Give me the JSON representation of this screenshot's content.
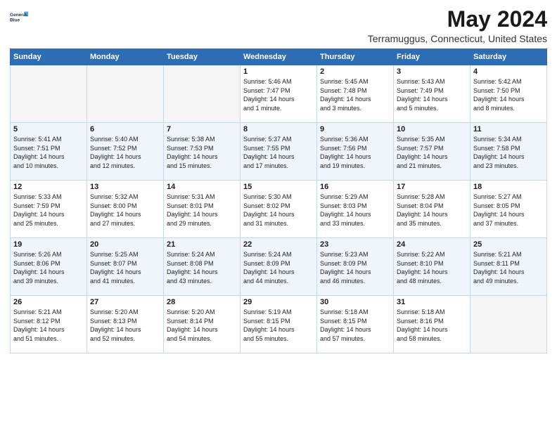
{
  "header": {
    "logo_line1": "General",
    "logo_line2": "Blue",
    "month_title": "May 2024",
    "location": "Terramuggus, Connecticut, United States"
  },
  "days_of_week": [
    "Sunday",
    "Monday",
    "Tuesday",
    "Wednesday",
    "Thursday",
    "Friday",
    "Saturday"
  ],
  "weeks": [
    [
      {
        "day": "",
        "info": ""
      },
      {
        "day": "",
        "info": ""
      },
      {
        "day": "",
        "info": ""
      },
      {
        "day": "1",
        "info": "Sunrise: 5:46 AM\nSunset: 7:47 PM\nDaylight: 14 hours\nand 1 minute."
      },
      {
        "day": "2",
        "info": "Sunrise: 5:45 AM\nSunset: 7:48 PM\nDaylight: 14 hours\nand 3 minutes."
      },
      {
        "day": "3",
        "info": "Sunrise: 5:43 AM\nSunset: 7:49 PM\nDaylight: 14 hours\nand 5 minutes."
      },
      {
        "day": "4",
        "info": "Sunrise: 5:42 AM\nSunset: 7:50 PM\nDaylight: 14 hours\nand 8 minutes."
      }
    ],
    [
      {
        "day": "5",
        "info": "Sunrise: 5:41 AM\nSunset: 7:51 PM\nDaylight: 14 hours\nand 10 minutes."
      },
      {
        "day": "6",
        "info": "Sunrise: 5:40 AM\nSunset: 7:52 PM\nDaylight: 14 hours\nand 12 minutes."
      },
      {
        "day": "7",
        "info": "Sunrise: 5:38 AM\nSunset: 7:53 PM\nDaylight: 14 hours\nand 15 minutes."
      },
      {
        "day": "8",
        "info": "Sunrise: 5:37 AM\nSunset: 7:55 PM\nDaylight: 14 hours\nand 17 minutes."
      },
      {
        "day": "9",
        "info": "Sunrise: 5:36 AM\nSunset: 7:56 PM\nDaylight: 14 hours\nand 19 minutes."
      },
      {
        "day": "10",
        "info": "Sunrise: 5:35 AM\nSunset: 7:57 PM\nDaylight: 14 hours\nand 21 minutes."
      },
      {
        "day": "11",
        "info": "Sunrise: 5:34 AM\nSunset: 7:58 PM\nDaylight: 14 hours\nand 23 minutes."
      }
    ],
    [
      {
        "day": "12",
        "info": "Sunrise: 5:33 AM\nSunset: 7:59 PM\nDaylight: 14 hours\nand 25 minutes."
      },
      {
        "day": "13",
        "info": "Sunrise: 5:32 AM\nSunset: 8:00 PM\nDaylight: 14 hours\nand 27 minutes."
      },
      {
        "day": "14",
        "info": "Sunrise: 5:31 AM\nSunset: 8:01 PM\nDaylight: 14 hours\nand 29 minutes."
      },
      {
        "day": "15",
        "info": "Sunrise: 5:30 AM\nSunset: 8:02 PM\nDaylight: 14 hours\nand 31 minutes."
      },
      {
        "day": "16",
        "info": "Sunrise: 5:29 AM\nSunset: 8:03 PM\nDaylight: 14 hours\nand 33 minutes."
      },
      {
        "day": "17",
        "info": "Sunrise: 5:28 AM\nSunset: 8:04 PM\nDaylight: 14 hours\nand 35 minutes."
      },
      {
        "day": "18",
        "info": "Sunrise: 5:27 AM\nSunset: 8:05 PM\nDaylight: 14 hours\nand 37 minutes."
      }
    ],
    [
      {
        "day": "19",
        "info": "Sunrise: 5:26 AM\nSunset: 8:06 PM\nDaylight: 14 hours\nand 39 minutes."
      },
      {
        "day": "20",
        "info": "Sunrise: 5:25 AM\nSunset: 8:07 PM\nDaylight: 14 hours\nand 41 minutes."
      },
      {
        "day": "21",
        "info": "Sunrise: 5:24 AM\nSunset: 8:08 PM\nDaylight: 14 hours\nand 43 minutes."
      },
      {
        "day": "22",
        "info": "Sunrise: 5:24 AM\nSunset: 8:09 PM\nDaylight: 14 hours\nand 44 minutes."
      },
      {
        "day": "23",
        "info": "Sunrise: 5:23 AM\nSunset: 8:09 PM\nDaylight: 14 hours\nand 46 minutes."
      },
      {
        "day": "24",
        "info": "Sunrise: 5:22 AM\nSunset: 8:10 PM\nDaylight: 14 hours\nand 48 minutes."
      },
      {
        "day": "25",
        "info": "Sunrise: 5:21 AM\nSunset: 8:11 PM\nDaylight: 14 hours\nand 49 minutes."
      }
    ],
    [
      {
        "day": "26",
        "info": "Sunrise: 5:21 AM\nSunset: 8:12 PM\nDaylight: 14 hours\nand 51 minutes."
      },
      {
        "day": "27",
        "info": "Sunrise: 5:20 AM\nSunset: 8:13 PM\nDaylight: 14 hours\nand 52 minutes."
      },
      {
        "day": "28",
        "info": "Sunrise: 5:20 AM\nSunset: 8:14 PM\nDaylight: 14 hours\nand 54 minutes."
      },
      {
        "day": "29",
        "info": "Sunrise: 5:19 AM\nSunset: 8:15 PM\nDaylight: 14 hours\nand 55 minutes."
      },
      {
        "day": "30",
        "info": "Sunrise: 5:18 AM\nSunset: 8:15 PM\nDaylight: 14 hours\nand 57 minutes."
      },
      {
        "day": "31",
        "info": "Sunrise: 5:18 AM\nSunset: 8:16 PM\nDaylight: 14 hours\nand 58 minutes."
      },
      {
        "day": "",
        "info": ""
      }
    ]
  ]
}
